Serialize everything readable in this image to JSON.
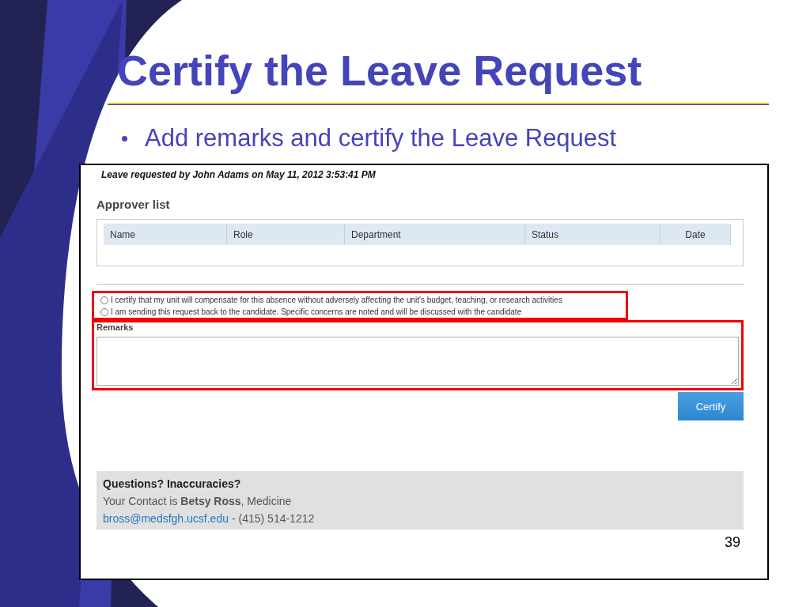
{
  "slide": {
    "title": "Certify the Leave Request",
    "bullets": [
      "Add remarks and certify the Leave Request"
    ],
    "page_number": "39"
  },
  "screen": {
    "request_info": "Leave requested by John Adams on May 11, 2012 3:53:41 PM",
    "approver_title": "Approver list",
    "columns": [
      "Name",
      "Role",
      "Department",
      "Status",
      "Date"
    ],
    "options": [
      {
        "label": "I certify that my unit will compensate for this absence without adversely affecting the unit's budget, teaching, or research activities",
        "selected": false
      },
      {
        "label": "I am sending this request back to the candidate. Specific concerns are noted and will be discussed with the candidate",
        "selected": false
      }
    ],
    "remarks_label": "Remarks",
    "button": "Certify",
    "contact": {
      "title": "Questions? Inaccuracies?",
      "line": "Your Contact is **Betsy Ross**, Medicine",
      "email": "bross@medsfgh.ucsf.edu",
      "phone": "- (415) 514-1212"
    }
  }
}
